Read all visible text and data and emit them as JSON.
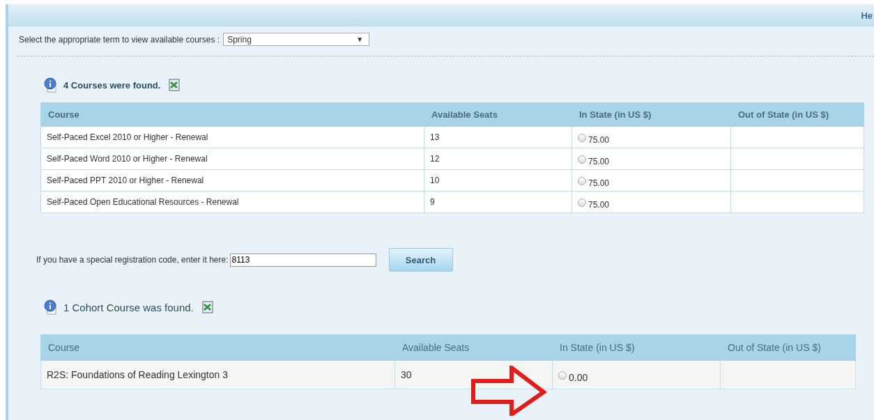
{
  "header": {
    "link": "He"
  },
  "term_select": {
    "label": "Select the appropriate term to view available courses :",
    "value": "Spring",
    "caret": "▼"
  },
  "courses": {
    "message": "4 Courses were found.",
    "columns": [
      "Course",
      "Available Seats",
      "In State (in US $)",
      "Out of State (in US $)"
    ],
    "rows": [
      {
        "course": "Self-Paced Excel 2010 or Higher - Renewal",
        "seats": "13",
        "in_state": "75.00",
        "selected": false
      },
      {
        "course": "Self-Paced Word 2010 or Higher - Renewal",
        "seats": "12",
        "in_state": "75.00",
        "selected": false
      },
      {
        "course": "Self-Paced PPT 2010 or Higher - Renewal",
        "seats": "10",
        "in_state": "75.00",
        "selected": false
      },
      {
        "course": "Self-Paced Open Educational Resources - Renewal",
        "seats": "9",
        "in_state": "75.00",
        "selected": false
      }
    ]
  },
  "registration": {
    "label": "If you have a special registration code, enter it here:",
    "value": "8113",
    "button": "Search"
  },
  "cohort": {
    "message": "1 Cohort Course was found.",
    "columns": [
      "Course",
      "Available Seats",
      "In State (in US $)",
      "Out of State (in US $)"
    ],
    "rows": [
      {
        "course": "R2S: Foundations of Reading Lexington 3",
        "seats": "30",
        "in_state": "0.00",
        "selected": false
      }
    ]
  }
}
